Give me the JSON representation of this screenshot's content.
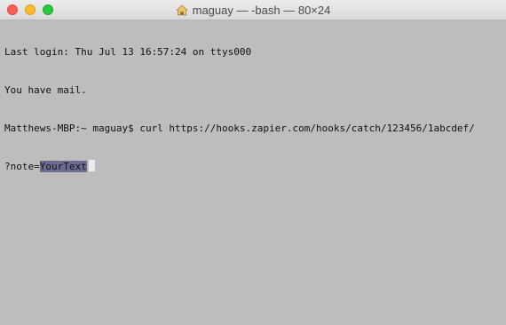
{
  "window": {
    "title": "maguay — -bash — 80×24"
  },
  "terminal": {
    "lines": [
      "Last login: Thu Jul 13 16:57:24 on ttys000",
      "You have mail.",
      "Matthews-MBP:~ maguay$ curl https://hooks.zapier.com/hooks/catch/123456/1abcdef/"
    ],
    "last_line_prefix": "?note=",
    "selected_text": "YourText"
  },
  "colors": {
    "background": "#bdbdbd",
    "selection": "#6b6b94"
  },
  "icons": {
    "title_icon": "home-icon"
  }
}
